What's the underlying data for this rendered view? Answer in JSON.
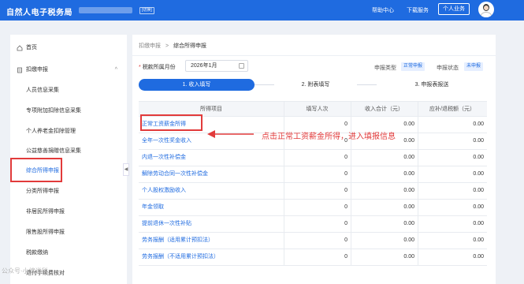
{
  "header": {
    "brand": "自然人电子税务局",
    "switch_label": "[切换]",
    "help": "帮助中心",
    "download": "下载服务",
    "biz_button": "个人业务"
  },
  "sidebar": {
    "items": [
      {
        "label": "首页",
        "icon": "home-icon"
      },
      {
        "label": "扣缴申报",
        "icon": "doc-icon",
        "chevron": "^"
      },
      {
        "label": "人员信息采集"
      },
      {
        "label": "专项附加扣除信息采集"
      },
      {
        "label": "个人养老金扣除管理"
      },
      {
        "label": "公益慈善捐赠信息采集"
      },
      {
        "label": "综合所得申报"
      },
      {
        "label": "分类所得申报"
      },
      {
        "label": "非居民所得申报"
      },
      {
        "label": "限售股所得申报"
      },
      {
        "label": "税款缴纳"
      },
      {
        "label": "退付手续费核对"
      }
    ],
    "collapse": "◀",
    "watermark": "公众号·小编说税"
  },
  "breadcrumb": {
    "parent": "扣缴申报",
    "sep": ">",
    "current": "综合所得申报"
  },
  "filter": {
    "required_mark": "*",
    "period_label": "税款所属月份",
    "period_value": "2026年1月",
    "type_label": "申报类型",
    "type_value": "正常申报",
    "status_label": "申报状态",
    "status_value": "未申报"
  },
  "steps": [
    "1. 收入填写",
    "2. 附表填写",
    "3. 申报表报送"
  ],
  "table": {
    "headers": [
      "所得项目",
      "填写人次",
      "收入合计（元）",
      "应补/退税额（元）"
    ],
    "rows": [
      {
        "name": "正常工资薪金所得",
        "count": "0",
        "income": "0.00",
        "tax": "0.00"
      },
      {
        "name": "全年一次性奖金收入",
        "count": "0",
        "income": "0.00",
        "tax": "0.00"
      },
      {
        "name": "内退一次性补偿金",
        "count": "0",
        "income": "0.00",
        "tax": "0.00"
      },
      {
        "name": "解除劳动合同一次性补偿金",
        "count": "0",
        "income": "0.00",
        "tax": "0.00"
      },
      {
        "name": "个人股权激励收入",
        "count": "0",
        "income": "0.00",
        "tax": "0.00"
      },
      {
        "name": "年金领取",
        "count": "0",
        "income": "0.00",
        "tax": "0.00"
      },
      {
        "name": "提前退休一次性补贴",
        "count": "0",
        "income": "0.00",
        "tax": "0.00"
      },
      {
        "name": "劳务报酬（适用累计预扣法）",
        "count": "0",
        "income": "0.00",
        "tax": "0.00"
      },
      {
        "name": "劳务报酬（不适用累计预扣法）",
        "count": "0",
        "income": "0.00",
        "tax": "0.00"
      }
    ]
  },
  "annotation": "点击正常工资薪金所得，进入填报信息"
}
